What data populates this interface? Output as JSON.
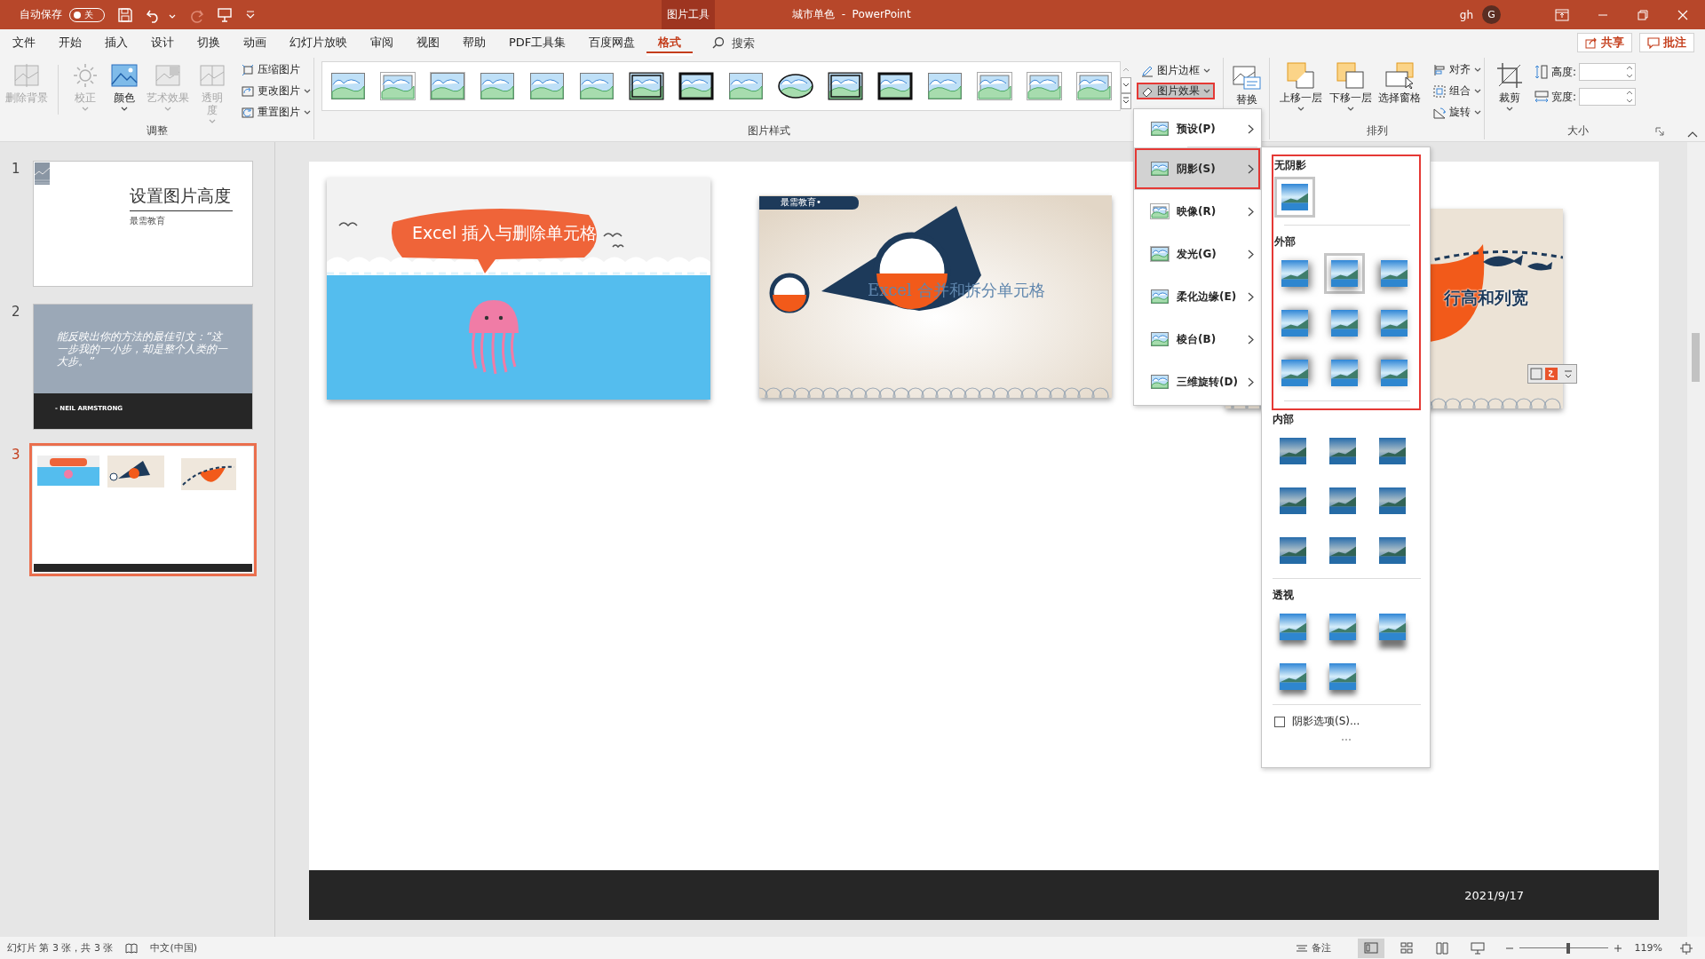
{
  "title_bar": {
    "autosave_label": "自动保存",
    "autosave_toggle": {
      "label": "关",
      "on": false
    },
    "contextual_tab": "图片工具",
    "window_title": "城市单色  -  PowerPoint",
    "user_name": "gh",
    "avatar_letter": "G"
  },
  "menu_tabs": [
    {
      "label": "文件",
      "selected": false
    },
    {
      "label": "开始",
      "selected": false
    },
    {
      "label": "插入",
      "selected": false
    },
    {
      "label": "设计",
      "selected": false
    },
    {
      "label": "切换",
      "selected": false
    },
    {
      "label": "动画",
      "selected": false
    },
    {
      "label": "幻灯片放映",
      "selected": false
    },
    {
      "label": "审阅",
      "selected": false
    },
    {
      "label": "视图",
      "selected": false
    },
    {
      "label": "帮助",
      "selected": false
    },
    {
      "label": "PDF工具集",
      "selected": false
    },
    {
      "label": "百度网盘",
      "selected": false
    },
    {
      "label": "格式",
      "selected": true
    }
  ],
  "search": {
    "placeholder": "搜索"
  },
  "actions": [
    {
      "kind": "share",
      "label": "共享"
    },
    {
      "kind": "comment",
      "label": "批注"
    }
  ],
  "adjust_group": {
    "title": "调整",
    "large_buttons": [
      {
        "kind": "remove_background",
        "label": "删除背景",
        "disabled": true,
        "dropdown": false
      },
      {
        "kind": "corrections",
        "label": "校正",
        "disabled": true,
        "dropdown": true
      },
      {
        "kind": "color",
        "label": "颜色",
        "disabled": false,
        "dropdown": true
      },
      {
        "kind": "artistic",
        "label": "艺术效果",
        "disabled": true,
        "dropdown": true
      },
      {
        "kind": "transparency",
        "label": "透明度",
        "disabled": true,
        "dropdown": true
      }
    ],
    "small_buttons": [
      {
        "kind": "compress",
        "label": "压缩图片",
        "dropdown": false
      },
      {
        "kind": "change",
        "label": "更改图片",
        "dropdown": true
      },
      {
        "kind": "reset",
        "label": "重置图片",
        "dropdown": true
      }
    ]
  },
  "styles_group": {
    "title": "图片样式",
    "buttons": [
      {
        "kind": "border",
        "label": "图片边框",
        "open": false,
        "highlighted": false
      },
      {
        "kind": "effects",
        "label": "图片效果",
        "open": true,
        "highlighted": true
      }
    ]
  },
  "replace_button": {
    "label": "替换"
  },
  "arrange_group": {
    "title": "排列",
    "large_buttons": [
      {
        "kind": "forward",
        "label": "上移一层"
      },
      {
        "kind": "backward",
        "label": "下移一层"
      },
      {
        "kind": "pane",
        "label": "选择窗格"
      }
    ],
    "small_buttons": [
      {
        "kind": "align",
        "label": "对齐"
      },
      {
        "kind": "group",
        "label": "组合"
      },
      {
        "kind": "rotate",
        "label": "旋转"
      }
    ]
  },
  "size_group": {
    "title": "大小",
    "crop_label": "裁剪",
    "height_label": "高度:",
    "width_label": "宽度:"
  },
  "effects_menu": {
    "items": [
      {
        "label": "预设(P)",
        "selected": false,
        "highlighted": false
      },
      {
        "label": "阴影(S)",
        "selected": true,
        "highlighted": true
      },
      {
        "label": "映像(R)",
        "selected": false,
        "highlighted": false
      },
      {
        "label": "发光(G)",
        "selected": false,
        "highlighted": false
      },
      {
        "label": "柔化边缘(E)",
        "selected": false,
        "highlighted": false
      },
      {
        "label": "棱台(B)",
        "selected": false,
        "highlighted": false
      },
      {
        "label": "三维旋转(D)",
        "selected": false,
        "highlighted": false
      }
    ]
  },
  "shadow_menu": {
    "highlighted": true,
    "sections": [
      {
        "kind": "none",
        "heading": "无阴影",
        "items": [
          {
            "selected": true
          }
        ]
      },
      {
        "kind": "outer",
        "heading": "外部",
        "items": [
          {
            "selected": false
          },
          {
            "selected": true
          },
          {
            "selected": false
          },
          {
            "selected": false
          },
          {
            "selected": false
          },
          {
            "selected": false
          },
          {
            "selected": false
          },
          {
            "selected": false
          },
          {
            "selected": false
          }
        ]
      },
      {
        "kind": "inner",
        "heading": "内部",
        "items": [
          {
            "selected": false
          },
          {
            "selected": false
          },
          {
            "selected": false
          },
          {
            "selected": false
          },
          {
            "selected": false
          },
          {
            "selected": false
          },
          {
            "selected": false
          },
          {
            "selected": false
          },
          {
            "selected": false
          }
        ]
      },
      {
        "kind": "perspective",
        "heading": "透视",
        "items": [
          {
            "selected": false
          },
          {
            "selected": false
          },
          {
            "selected": false
          },
          {
            "selected": false
          },
          {
            "selected": false
          }
        ]
      }
    ],
    "options": {
      "label": "阴影选项(S)...",
      "checked": false
    }
  },
  "slides_pane": [
    {
      "number": "1",
      "kind": "title",
      "selected": false,
      "title": "设置图片高度",
      "subtitle": "最需教育"
    },
    {
      "number": "2",
      "kind": "quote",
      "selected": false,
      "quote": "能反映出你的方法的最佳引文：“这一步我的一小步，却是整个人类的一大步。”",
      "attribution": "- NEIL ARMSTRONG"
    },
    {
      "number": "3",
      "kind": "pictures",
      "selected": true
    }
  ],
  "slide": {
    "graphics": [
      {
        "kind": "bubble",
        "caption": "Excel 插入与删除单元格"
      },
      {
        "kind": "funnel",
        "label": "最需教育•",
        "caption": "Excel 合并和拆分单元格"
      },
      {
        "kind": "fish",
        "caption": "行高和列宽"
      }
    ],
    "footer_date": "2021/9/17"
  },
  "status_bar": {
    "slide_info": "幻灯片 第 3 张，共 3 张",
    "language": "中文(中国)",
    "notes": "备注",
    "views": [
      {
        "kind": "normal",
        "selected": true
      },
      {
        "kind": "sorter",
        "selected": false
      },
      {
        "kind": "reading",
        "selected": false
      },
      {
        "kind": "show",
        "selected": false
      }
    ],
    "zoom": {
      "level": 0.55,
      "label": "119%"
    }
  }
}
